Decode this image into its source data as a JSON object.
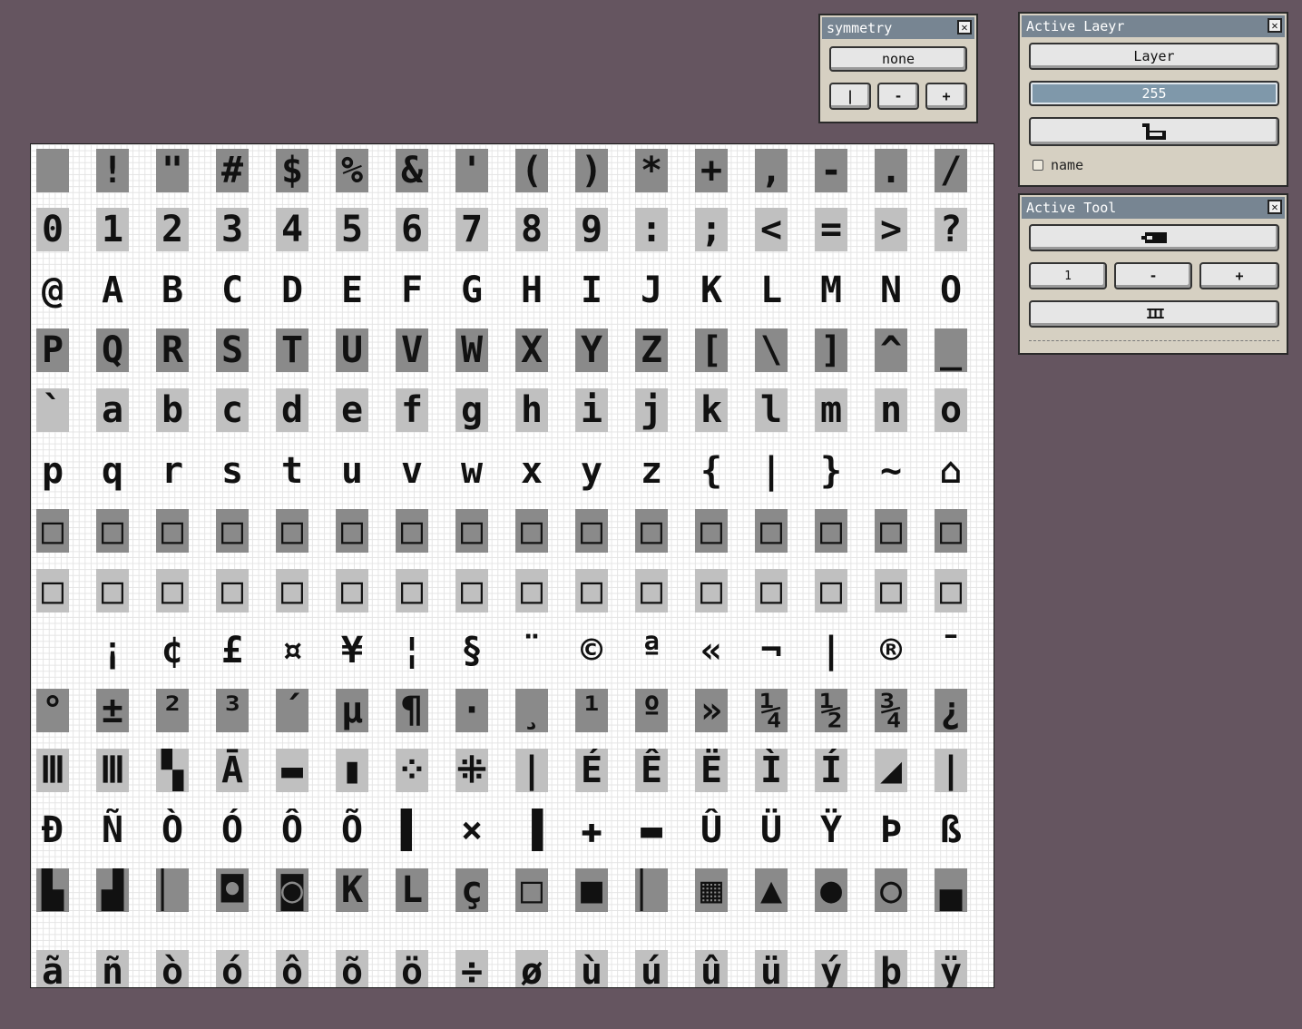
{
  "symmetry_panel": {
    "title": "symmetry",
    "mode": "none",
    "buttons": [
      "|",
      "-",
      "+"
    ]
  },
  "layer_panel": {
    "title": "Active Laeyr",
    "layer_button": "Layer",
    "opacity_value": "255",
    "lock_icon": "lock-icon",
    "name_checkbox_label": "name",
    "name_checked": false
  },
  "tool_panel": {
    "title": "Active Tool",
    "tool_icon": "eraser-icon",
    "size_value": "1",
    "size_minus": "-",
    "size_plus": "+",
    "brush_glyph": "III"
  },
  "glyph_rows": [
    [
      " ",
      "!",
      "\"",
      "#",
      "$",
      "%",
      "&",
      "'",
      "(",
      ")",
      "*",
      "+",
      ",",
      "-",
      ".",
      "/"
    ],
    [
      "0",
      "1",
      "2",
      "3",
      "4",
      "5",
      "6",
      "7",
      "8",
      "9",
      ":",
      ";",
      "<",
      "=",
      ">",
      "?"
    ],
    [
      "@",
      "A",
      "B",
      "C",
      "D",
      "E",
      "F",
      "G",
      "H",
      "I",
      "J",
      "K",
      "L",
      "M",
      "N",
      "O"
    ],
    [
      "P",
      "Q",
      "R",
      "S",
      "T",
      "U",
      "V",
      "W",
      "X",
      "Y",
      "Z",
      "[",
      "\\",
      "]",
      "^",
      "_"
    ],
    [
      "`",
      "a",
      "b",
      "c",
      "d",
      "e",
      "f",
      "g",
      "h",
      "i",
      "j",
      "k",
      "l",
      "m",
      "n",
      "o"
    ],
    [
      "p",
      "q",
      "r",
      "s",
      "t",
      "u",
      "v",
      "w",
      "x",
      "y",
      "z",
      "{",
      "|",
      "}",
      "~",
      "⌂"
    ],
    [
      "□",
      "□",
      "□",
      "□",
      "□",
      "□",
      "□",
      "□",
      "□",
      "□",
      "□",
      "□",
      "□",
      "□",
      "□",
      "□"
    ],
    [
      "□",
      "□",
      "□",
      "□",
      "□",
      "□",
      "□",
      "□",
      "□",
      "□",
      "□",
      "□",
      "□",
      "□",
      "□",
      "□"
    ],
    [
      " ",
      "¡",
      "¢",
      "£",
      "¤",
      "¥",
      "¦",
      "§",
      "¨",
      "©",
      "ª",
      "«",
      "¬",
      "|",
      "®",
      "¯"
    ],
    [
      "°",
      "±",
      "²",
      "³",
      "´",
      "µ",
      "¶",
      "·",
      "¸",
      "¹",
      "º",
      "»",
      "¼",
      "½",
      "¾",
      "¿"
    ],
    [
      "Ⅲ",
      "Ⅲ",
      "▚",
      "Ā",
      "▬",
      "▮",
      "⁘",
      "⁜",
      "|",
      "É",
      "Ê",
      "Ë",
      "Ì",
      "Í",
      "◢",
      "|"
    ],
    [
      "Ð",
      "Ñ",
      "Ò",
      "Ó",
      "Ô",
      "Õ",
      "▌",
      "×",
      "▐",
      "✚",
      "▬",
      "Û",
      "Ü",
      "Ÿ",
      "Þ",
      "ß"
    ],
    [
      "▙",
      "▟",
      "▏",
      "◘",
      "◙",
      "K",
      "L",
      "ç",
      "□",
      "■",
      "▏",
      "▦",
      "▲",
      "●",
      "○",
      "▄"
    ],
    [
      "ã",
      "ñ",
      "ò",
      "ó",
      "ô",
      "õ",
      "ö",
      "÷",
      "ø",
      "ù",
      "ú",
      "û",
      "ü",
      "ý",
      "þ",
      "ÿ"
    ]
  ],
  "colors": {
    "background": "#655560",
    "panel": "#d6d0c2",
    "title_bar": "#778592",
    "accent_blue": "#7f98aa"
  }
}
